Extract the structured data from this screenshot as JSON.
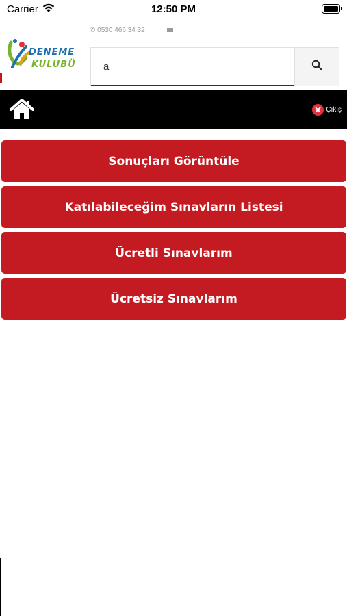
{
  "status_bar": {
    "carrier": "Carrier",
    "time": "12:50 PM"
  },
  "header": {
    "phone": "0530 466 34 32",
    "logo": {
      "line1": "DENEME",
      "line2": "KULUBÜ"
    },
    "search": {
      "value": "a",
      "icon": "search-icon"
    }
  },
  "navbar": {
    "home_icon": "home-icon",
    "logout_icon": "close-circle-icon",
    "logout_label": "Çıkış"
  },
  "menu": {
    "items": [
      {
        "label": "Sonuçları Görüntüle"
      },
      {
        "label": "Katılabileceğim Sınavların Listesi"
      },
      {
        "label": "Ücretli Sınavlarım"
      },
      {
        "label": "Ücretsiz Sınavlarım"
      }
    ]
  },
  "colors": {
    "brand_red": "#c41a21",
    "nav_black": "#000000",
    "logo_blue": "#1e6fb0",
    "logo_green": "#7ab32e"
  }
}
